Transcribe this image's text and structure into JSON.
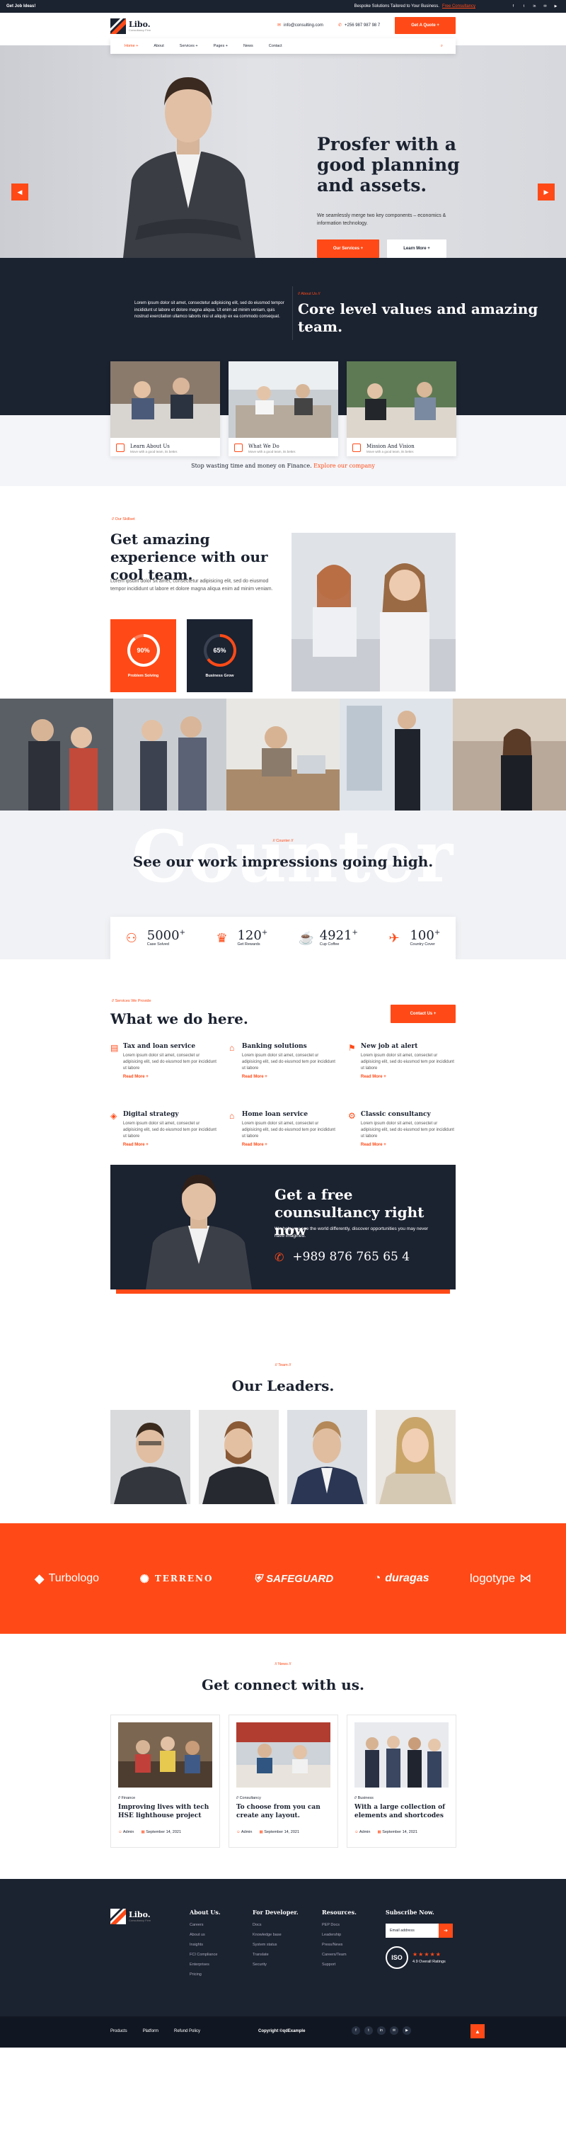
{
  "topbar": {
    "left": "Get Job Ideas!",
    "promo": "Bespoke Solutions Tailored to Your Business.",
    "promo_link": "Free Consultancy"
  },
  "header": {
    "logo_name": "Libo.",
    "logo_tag": "Consultancy Firm",
    "email": "info@consulting.com",
    "phone": "+256 987 987 98 7",
    "cta": "Get A Quote +"
  },
  "nav": [
    "Home +",
    "About",
    "Services +",
    "Pages +",
    "News",
    "Contact"
  ],
  "hero": {
    "title": "Prosfer with a good planning and assets.",
    "text": "We seamlessly merge two key components – economics & information technology.",
    "btn_primary": "Our Services +",
    "btn_secondary": "Learn More +"
  },
  "about": {
    "text": "Lorem ipsum dolor sit amet, consectetur adipisicing elit, sed do eiusmod tempor incididunt ut labore et dolore magna aliqua. Ut enim ad minim veniam, quis nostrud exercitation ullamco laboris nisi ut aliquip ex ea commodo consequat.",
    "sub": "// About Us //",
    "title": "Core level values and amazing team.",
    "cards": [
      {
        "title": "Learn About Us",
        "sub": "Move with a good team, its better."
      },
      {
        "title": "What We Do",
        "sub": "Move with a good team, its better."
      },
      {
        "title": "Mission And Vision",
        "sub": "Move with a good team, its better."
      }
    ],
    "stop": "Stop wasting time and money on Finance.",
    "stop_link": "Explore our company"
  },
  "skills": {
    "sub": "// Our Skillset",
    "title": "Get amazing experience with our cool team.",
    "text": "Lorem ipsum dolor sit amet, consectetur adipisicing elit, sed do eiusmod tempor incididunt ut labore et dolore magna aliqua enim ad minim veniam.",
    "gauges": [
      {
        "value": "90%",
        "label": "Problem Solving",
        "pct": 90
      },
      {
        "value": "65%",
        "label": "Business Grow",
        "pct": 65
      }
    ]
  },
  "counter": {
    "watermark": "Counter",
    "sub": "// Counter //",
    "title": "See our work impressions going high.",
    "stats": [
      {
        "num": "5000",
        "label": "Case Solved"
      },
      {
        "num": "120",
        "label": "Get Rewards"
      },
      {
        "num": "4921",
        "label": "Cup Coffee"
      },
      {
        "num": "100",
        "label": "Country Cover"
      }
    ],
    "plus": "+"
  },
  "services": {
    "sub": "// Services We Provide",
    "title": "What we do here.",
    "cta": "Contact Us +",
    "read_more": "Read More +",
    "items": [
      {
        "title": "Tax and loan service",
        "text": "Lorem ipsum dolor sit amet, consectet ur adipisicing elit, sed do eiusmod tem por incididunt ut labore"
      },
      {
        "title": "Banking solutions",
        "text": "Lorem ipsum dolor sit amet, consectet ur adipisicing elit, sed do eiusmod tem por incididunt ut labore"
      },
      {
        "title": "New job at alert",
        "text": "Lorem ipsum dolor sit amet, consectet ur adipisicing elit, sed do eiusmod tem por incididunt ut labore"
      },
      {
        "title": "Digital strategy",
        "text": "Lorem ipsum dolor sit amet, consectet ur adipisicing elit, sed do eiusmod tem por incididunt ut labore"
      },
      {
        "title": "Home loan service",
        "text": "Lorem ipsum dolor sit amet, consectet ur adipisicing elit, sed do eiusmod tem por incididunt ut labore"
      },
      {
        "title": "Classic consultancy",
        "text": "Lorem ipsum dolor sit amet, consectet ur adipisicing elit, sed do eiusmod tem por incididunt ut labore"
      }
    ]
  },
  "consult": {
    "title": "Get a free counsultancy right now",
    "text": "We help you see the world differently, discover opportunities you may never have imagined.",
    "phone": "+989 876 765 65 4"
  },
  "team": {
    "sub": "// Team //",
    "title": "Our Leaders."
  },
  "brands": [
    "Turbologo",
    "TERRENO",
    "SAFEGUARD",
    "duragas",
    "logotype"
  ],
  "news": {
    "sub": "// News //",
    "title": "Get connect with us.",
    "items": [
      {
        "cat": "// Finance",
        "title": "Improving lives with tech HSE lighthouse project",
        "author": "Admin",
        "date": "September 14, 2021"
      },
      {
        "cat": "// Consultancy",
        "title": "To choose from you can create any layout.",
        "author": "Admin",
        "date": "September 14, 2021"
      },
      {
        "cat": "// Business",
        "title": "With a large collection of elements and shortcodes",
        "author": "Admin",
        "date": "September 14, 2021"
      }
    ]
  },
  "footer": {
    "cols": [
      {
        "title": "About Us.",
        "items": [
          "Careers",
          "About us",
          "Insights",
          "FCI Compliance",
          "Enterprises",
          "Pricing"
        ]
      },
      {
        "title": "For Developer.",
        "items": [
          "Docs",
          "Knowledge base",
          "System status",
          "Translate",
          "Security"
        ]
      },
      {
        "title": "Resources.",
        "items": [
          "PEP Docs",
          "Leadership",
          "Press/News",
          "Careers/Team",
          "Support"
        ]
      }
    ],
    "subscribe_title": "Subscribe Now.",
    "email_placeholder": "Email address",
    "iso": "ISO",
    "rating": "4.9 Overall Ratings",
    "bottom_links": [
      "Products",
      "Platform",
      "Refund Policy"
    ],
    "copyright": "Copyright ©qdExample"
  }
}
